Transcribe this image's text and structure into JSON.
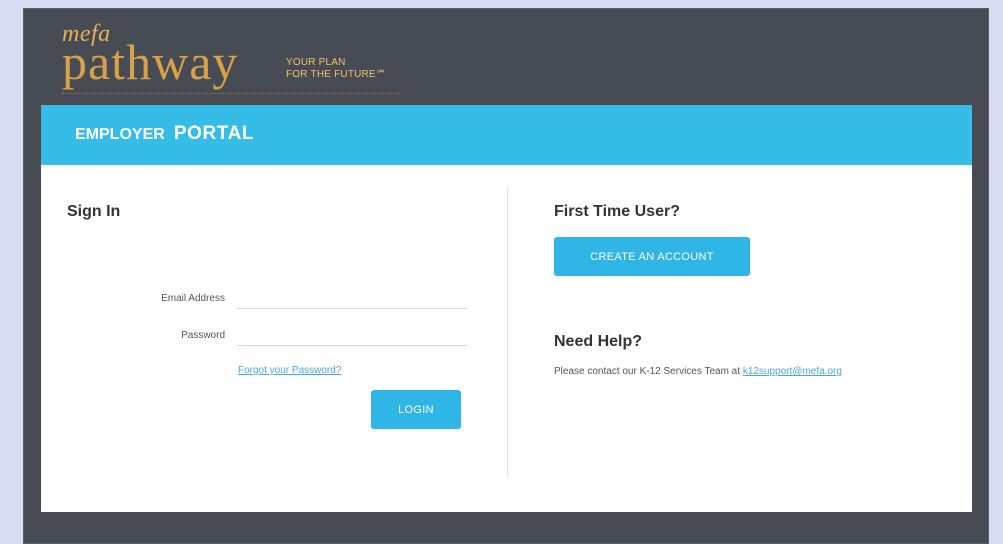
{
  "brand": {
    "mefa": "mefa",
    "pathway": "pathway",
    "tagline_line1": "YOUR PLAN",
    "tagline_line2": "FOR THE FUTURE℠"
  },
  "header": {
    "portal_word1": "EMPLOYER",
    "portal_word2": "PORTAL"
  },
  "sign_in": {
    "title": "Sign In",
    "email_label": "Email Address",
    "email_value": "",
    "password_label": "Password",
    "password_value": "",
    "forgot_link": "Forgot your Password?",
    "login_button": "LOGIN"
  },
  "first_time": {
    "title": "First Time User?",
    "create_button": "CREATE AN ACCOUNT"
  },
  "help": {
    "title": "Need Help?",
    "text": "Please contact our K-12 Services Team at ",
    "email_link": "k12support@mefa.org"
  },
  "colors": {
    "portal_bar": "#35bde8",
    "button": "#2fb6e6",
    "frame": "#474b53",
    "logo_gold": "#d7a14a"
  }
}
